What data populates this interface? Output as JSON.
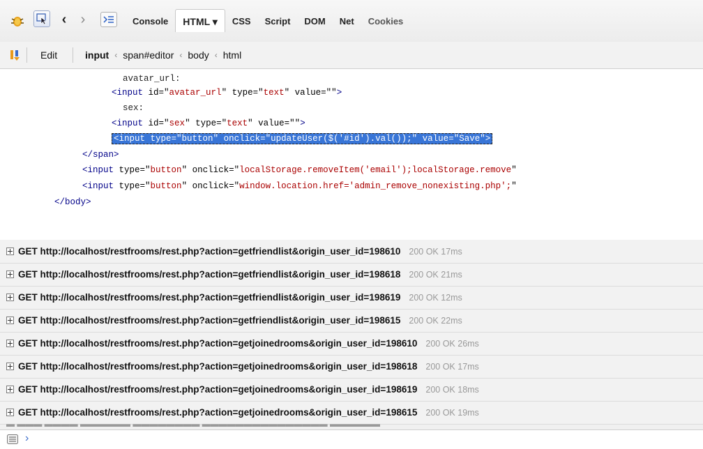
{
  "toolbar": {
    "tabs": [
      {
        "label": "Console"
      },
      {
        "label": "HTML ▾"
      },
      {
        "label": "CSS"
      },
      {
        "label": "Script"
      },
      {
        "label": "DOM"
      },
      {
        "label": "Net"
      },
      {
        "label": "Cookies"
      }
    ]
  },
  "breadcrumb": {
    "edit_label": "Edit",
    "items": [
      "input",
      "span#editor",
      "body",
      "html"
    ]
  },
  "html_panel": {
    "lines": [
      {
        "indent": 176,
        "parts": [
          "avatar_url:"
        ]
      },
      {
        "indent": 160,
        "tag_open": "<input ",
        "attrs": [
          [
            "id",
            "avatar_url"
          ],
          [
            "type",
            "text"
          ],
          [
            "value",
            ""
          ]
        ],
        "tag_close": ">"
      },
      {
        "indent": 176,
        "parts": [
          "sex:"
        ]
      },
      {
        "indent": 160,
        "tag_open": "<input ",
        "attrs": [
          [
            "id",
            "sex"
          ],
          [
            "type",
            "text"
          ],
          [
            "value",
            ""
          ]
        ],
        "tag_close": ">"
      },
      {
        "indent": 160,
        "selected": true,
        "tag_open": "<input ",
        "attrs": [
          [
            "type",
            "button"
          ],
          [
            "onclick",
            "updateUser($('#id').val());"
          ],
          [
            "value",
            "Save"
          ]
        ],
        "tag_close": ">"
      },
      {
        "indent": 118,
        "tag_only": "</span>"
      },
      {
        "indent": 118,
        "tag_open": "<input ",
        "attrs": [
          [
            "type",
            "button"
          ],
          [
            "onclick",
            "localStorage.removeItem('email');localStorage.remove"
          ]
        ],
        "tag_close": ""
      },
      {
        "indent": 118,
        "tag_open": "<input ",
        "attrs": [
          [
            "type",
            "button"
          ],
          [
            "onclick",
            "window.location.href='admin_remove_nonexisting.php';"
          ]
        ],
        "tag_close": ""
      },
      {
        "indent": 78,
        "tag_only": "</body>"
      }
    ]
  },
  "net_log": {
    "requests": [
      {
        "text": "GET http://localhost/restfrooms/rest.php?action=getfriendlist&origin_user_id=198610",
        "status": "200 OK 17ms"
      },
      {
        "text": "GET http://localhost/restfrooms/rest.php?action=getfriendlist&origin_user_id=198618",
        "status": "200 OK 21ms"
      },
      {
        "text": "GET http://localhost/restfrooms/rest.php?action=getfriendlist&origin_user_id=198619",
        "status": "200 OK 12ms"
      },
      {
        "text": "GET http://localhost/restfrooms/rest.php?action=getfriendlist&origin_user_id=198615",
        "status": "200 OK 22ms"
      },
      {
        "text": "GET http://localhost/restfrooms/rest.php?action=getjoinedrooms&origin_user_id=198610",
        "status": "200 OK 26ms"
      },
      {
        "text": "GET http://localhost/restfrooms/rest.php?action=getjoinedrooms&origin_user_id=198618",
        "status": "200 OK 17ms"
      },
      {
        "text": "GET http://localhost/restfrooms/rest.php?action=getjoinedrooms&origin_user_id=198619",
        "status": "200 OK 18ms"
      },
      {
        "text": "GET http://localhost/restfrooms/rest.php?action=getjoinedrooms&origin_user_id=198615",
        "status": "200 OK 19ms"
      }
    ]
  },
  "command_line": {
    "prompt": "›"
  }
}
